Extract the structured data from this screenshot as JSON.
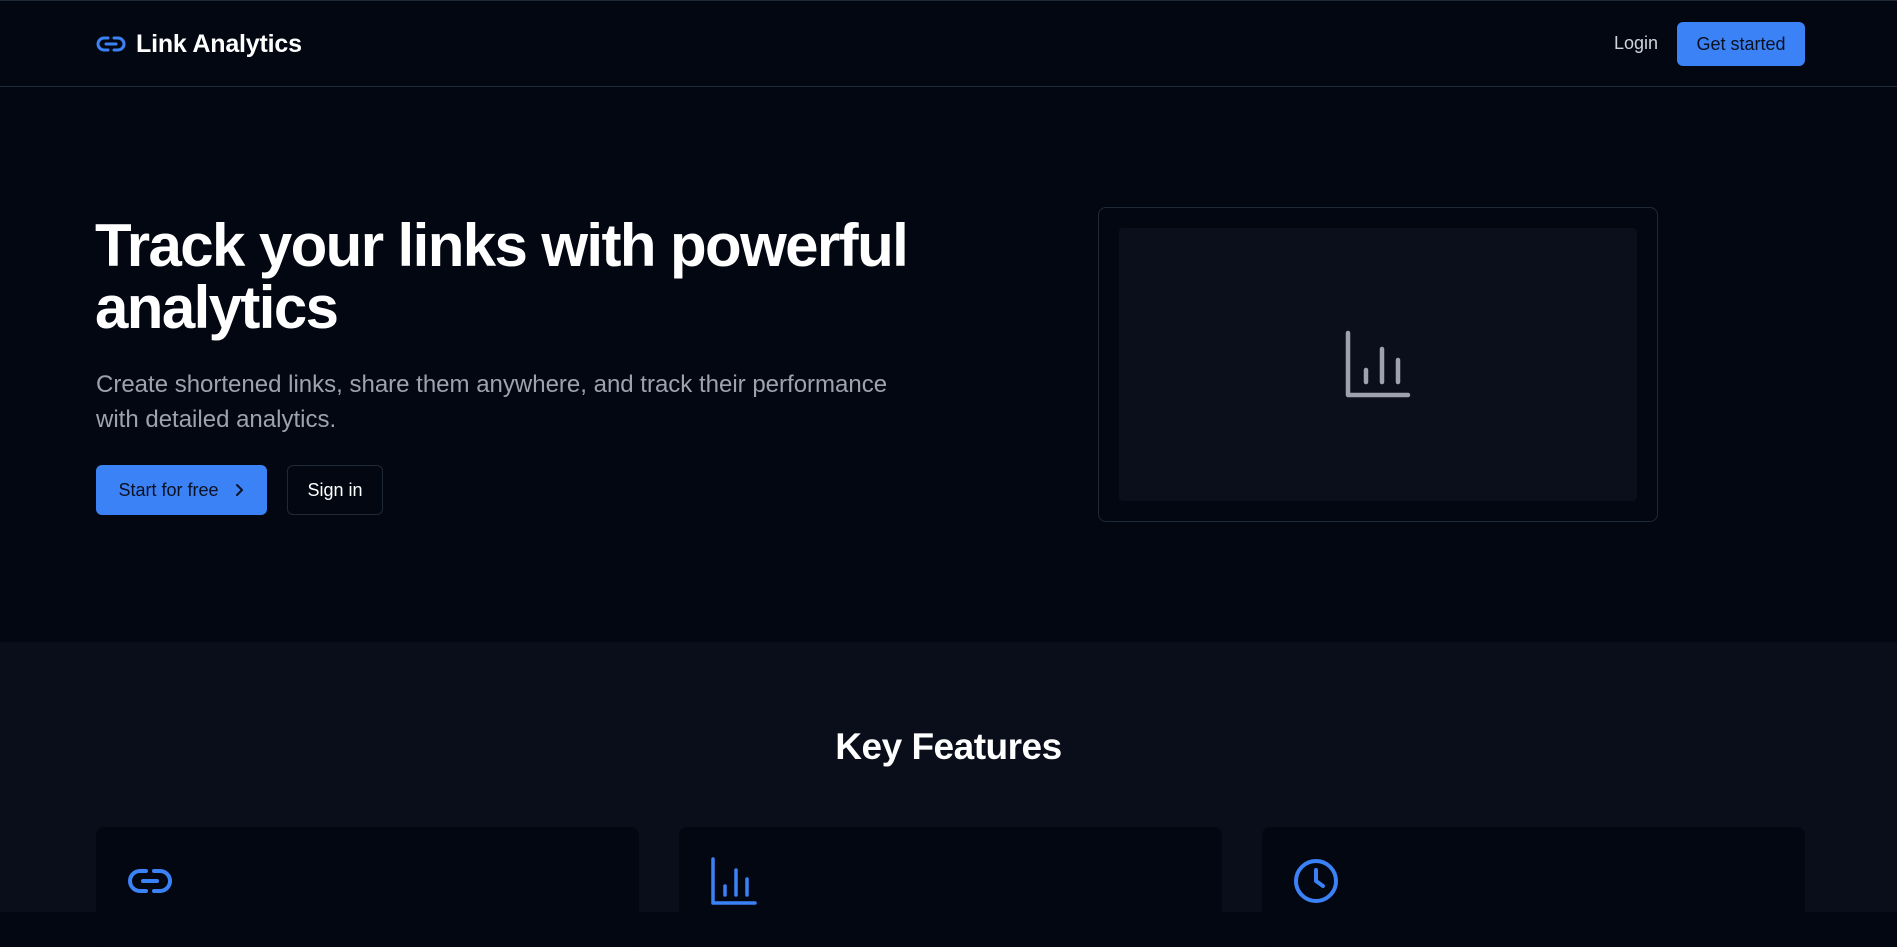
{
  "nav": {
    "brand": "Link Analytics",
    "brand_icon": "link-icon",
    "login": "Login",
    "cta": "Get started"
  },
  "hero": {
    "title": "Track your links with powerful analytics",
    "subtitle": "Create shortened links, share them anywhere, and track their performance with detailed analytics.",
    "primary_button": "Start for free",
    "primary_icon": "chevron-right-icon",
    "secondary_button": "Sign in",
    "preview_icon": "bar-chart-icon"
  },
  "features": {
    "title": "Key Features",
    "cards": [
      {
        "icon": "link-icon"
      },
      {
        "icon": "bar-chart-icon"
      },
      {
        "icon": "clock-icon"
      }
    ]
  },
  "colors": {
    "background": "#030712",
    "section_background": "#0a0e1a",
    "accent": "#3b82f6",
    "muted_text": "#9ca3af",
    "border": "#1f2937"
  }
}
